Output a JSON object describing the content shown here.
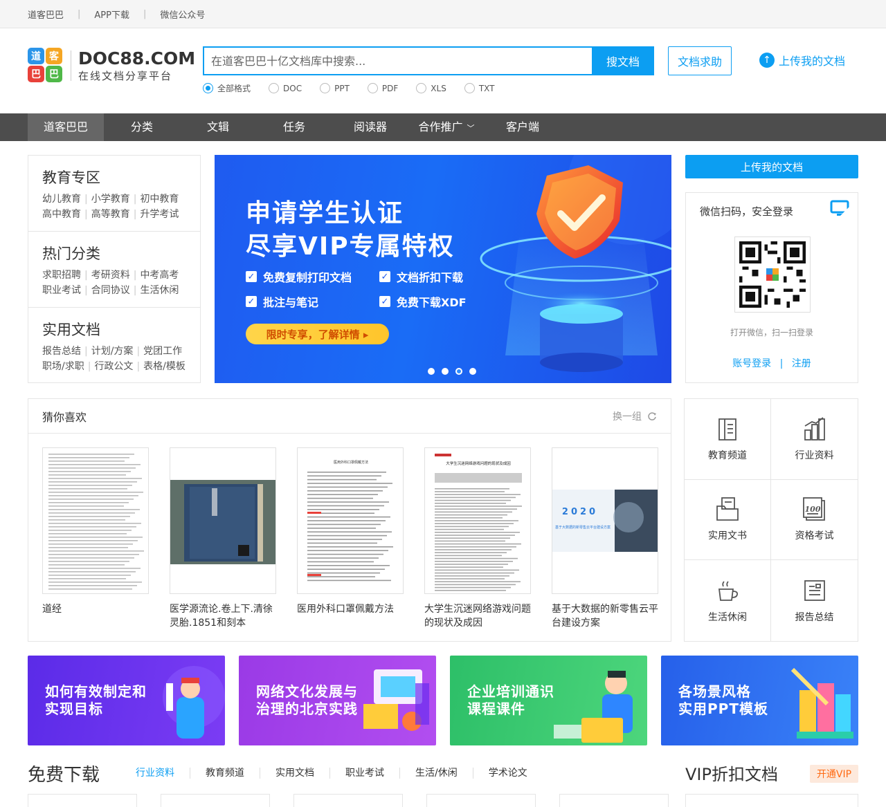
{
  "topbar": {
    "links": [
      "道客巴巴",
      "APP下载",
      "微信公众号"
    ],
    "sep": "|"
  },
  "logo": {
    "mark_chars": [
      "道",
      "客",
      "巴",
      "巴"
    ],
    "brand": "DOC88.COM",
    "slogan": "在线文档分享平台"
  },
  "search": {
    "placeholder": "在道客巴巴十亿文档库中搜索...",
    "button": "搜文档",
    "formats": [
      "全部格式",
      "DOC",
      "PPT",
      "PDF",
      "XLS",
      "TXT"
    ],
    "selected_format": "全部格式"
  },
  "header": {
    "help_button": "文档求助",
    "upload_link": "上传我的文档"
  },
  "nav": {
    "items": [
      "道客巴巴",
      "分类",
      "文辑",
      "任务",
      "阅读器",
      "合作推广",
      "客户端"
    ],
    "active": "道客巴巴"
  },
  "categories": [
    {
      "title": "教育专区",
      "rows": [
        [
          "幼儿教育",
          "小学教育",
          "初中教育"
        ],
        [
          "高中教育",
          "高等教育",
          "升学考试"
        ]
      ]
    },
    {
      "title": "热门分类",
      "rows": [
        [
          "求职招聘",
          "考研资料",
          "中考高考"
        ],
        [
          "职业考试",
          "合同协议",
          "生活休闲"
        ]
      ]
    },
    {
      "title": "实用文档",
      "rows": [
        [
          "报告总结",
          "计划/方案",
          "党团工作"
        ],
        [
          "职场/求职",
          "行政公文",
          "表格/模板"
        ]
      ]
    }
  ],
  "banner": {
    "title_line1": "申请学生认证",
    "title_line2": "尽享VIP专属特权",
    "features": [
      "免费复制打印文档",
      "文档折扣下载",
      "批注与笔记",
      "免费下载XDF"
    ],
    "cta": "限时专享，了解详情 ▸",
    "dots": 4,
    "active_dot": 3
  },
  "sidebar": {
    "upload_button": "上传我的文档",
    "login_title": "微信扫码，安全登录",
    "qr_hint": "打开微信，扫一扫登录",
    "account_login": "账号登录",
    "link_sep": "|",
    "register": "注册"
  },
  "guess": {
    "title": "猜你喜欢",
    "refresh": "换一组",
    "docs": [
      {
        "name": "道经"
      },
      {
        "name": "医学源流论.卷上下.清徐灵胎.1851和刻本"
      },
      {
        "name": "医用外科口罩佩戴方法"
      },
      {
        "name": "大学生沉迷网络游戏问题的现状及成因"
      },
      {
        "name": "基于大数据的新零售云平台建设方案"
      }
    ],
    "thumb_texts": {
      "doc3_title": "医用外科口罩佩戴方法",
      "doc4_title": "大学生沉迷网络游戏问题的现状及成因",
      "doc5_year": "2020",
      "doc5_caption": "基于大数据的新零售云平台建设方案"
    }
  },
  "channels": [
    {
      "label": "教育频道",
      "icon": "book-icon"
    },
    {
      "label": "行业资料",
      "icon": "chart-icon"
    },
    {
      "label": "实用文书",
      "icon": "folder-doc-icon"
    },
    {
      "label": "资格考试",
      "icon": "exam-100-icon"
    },
    {
      "label": "生活休闲",
      "icon": "coffee-cup-icon"
    },
    {
      "label": "报告总结",
      "icon": "report-icon"
    }
  ],
  "promos": [
    {
      "line1": "如何有效制定和",
      "line2": "实现目标",
      "color": "#6a2ef0"
    },
    {
      "line1": "网络文化发展与",
      "line2": "治理的北京实践",
      "color": "#a73ce8"
    },
    {
      "line1": "企业培训通识",
      "line2": "课程课件",
      "color": "#2fc46a"
    },
    {
      "line1": "各场景风格",
      "line2": "实用PPT模板",
      "color": "#2c6cf0"
    }
  ],
  "bottom": {
    "free_title": "免费下载",
    "tabs": [
      "行业资料",
      "教育频道",
      "实用文档",
      "职业考试",
      "生活/休闲",
      "学术论文"
    ],
    "active_tab": "行业资料",
    "vip_title": "VIP折扣文档",
    "vip_button": "开通VIP"
  },
  "colors": {
    "accent": "#0c9ef2",
    "nav_bg": "#4d4d4d",
    "nav_active": "#666666",
    "vip_orange": "#ff6a13"
  }
}
